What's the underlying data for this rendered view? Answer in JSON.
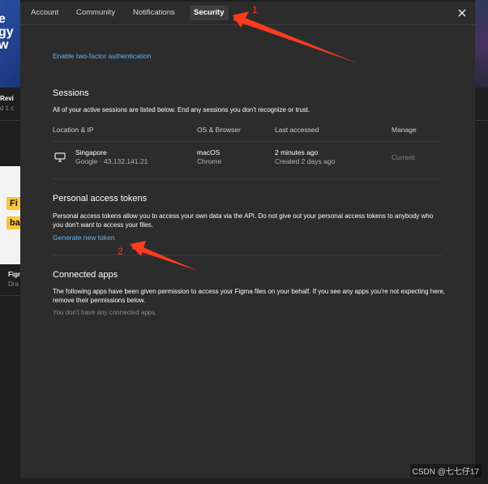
{
  "background": {
    "hero_text": "e\ngy\nw",
    "card_title": "Revi",
    "card_sub": "d 1 c",
    "chip1": "Fi",
    "chip2": "ba",
    "figma_title": "Figma",
    "figma_sub": "Dra"
  },
  "tabs": [
    {
      "label": "Account"
    },
    {
      "label": "Community"
    },
    {
      "label": "Notifications"
    },
    {
      "label": "Security",
      "active": true
    }
  ],
  "security": {
    "two_factor_link": "Enable two-factor authentication",
    "sessions": {
      "title": "Sessions",
      "description": "All of your active sessions are listed below. End any sessions you don't recognize or trust.",
      "columns": [
        "Location & IP",
        "OS & Browser",
        "Last accessed",
        "Manage"
      ],
      "rows": [
        {
          "device_icon": "monitor-icon",
          "location": "Singapore",
          "ip": "Google · 43.132.141.21",
          "os": "macOS",
          "browser": "Chrome",
          "last_accessed": "2 minutes ago",
          "created": "Created 2 days ago",
          "manage": "Current"
        }
      ]
    },
    "tokens": {
      "title": "Personal access tokens",
      "description": "Personal access tokens allow you to access your own data via the API. Do not give out your personal access tokens to anybody who you don't want to access your files.",
      "generate_link": "Generate new token"
    },
    "connected_apps": {
      "title": "Connected apps",
      "description": "The following apps have been given permission to access your Figma files on your behalf. If you see any apps you're not expecting here, remove their permissions below.",
      "empty_text": "You don't have any connected apps."
    }
  },
  "annotations": {
    "marker1": "1",
    "marker2": "2",
    "color": "#ff3b1f"
  },
  "watermark": "CSDN @七七仔17",
  "colors": {
    "modal_bg": "#2c2c2c",
    "link": "#63b2f0",
    "page_bg": "#1e1e1e"
  }
}
